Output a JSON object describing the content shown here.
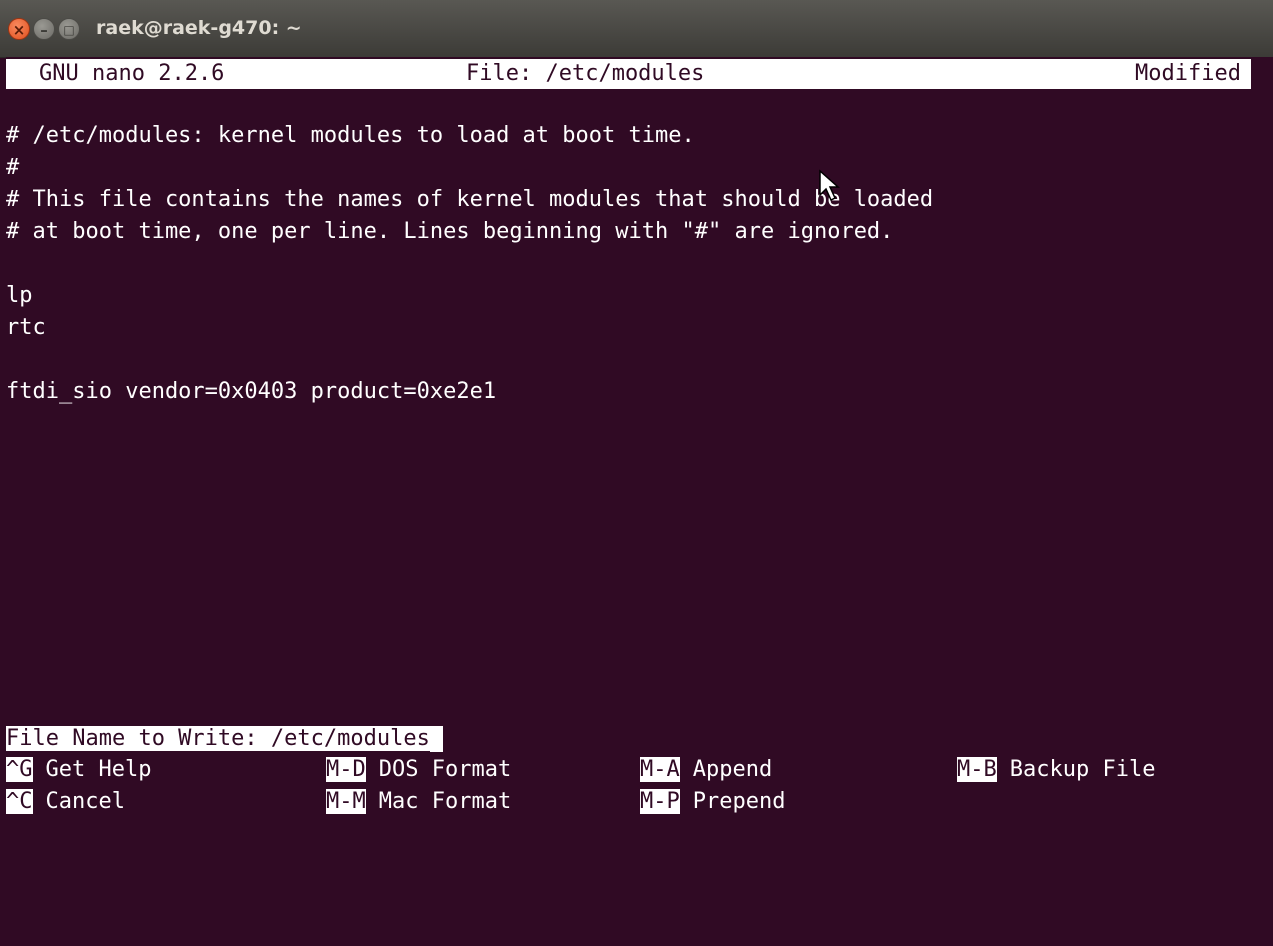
{
  "window": {
    "title": "raek@raek-g470: ~",
    "close_glyph": "×",
    "minimize_glyph": "–",
    "maximize_glyph": "□"
  },
  "nano": {
    "version": "GNU nano 2.2.6",
    "file_label": "File: /etc/modules",
    "status": "Modified"
  },
  "file_lines": [
    "# /etc/modules: kernel modules to load at boot time.",
    "#",
    "# This file contains the names of kernel modules that should be loaded",
    "# at boot time, one per line. Lines beginning with \"#\" are ignored.",
    "",
    "lp",
    "rtc",
    "",
    "ftdi_sio vendor=0x0403 product=0xe2e1"
  ],
  "prompt": {
    "label": "File Name to Write: ",
    "value": "/etc/modules"
  },
  "shortcuts": {
    "row1": [
      {
        "key": "^G",
        "label": "Get Help"
      },
      {
        "key": "M-D",
        "label": "DOS Format"
      },
      {
        "key": "M-A",
        "label": "Append"
      },
      {
        "key": "M-B",
        "label": "Backup File"
      }
    ],
    "row2": [
      {
        "key": "^C",
        "label": "Cancel"
      },
      {
        "key": "M-M",
        "label": "Mac Format"
      },
      {
        "key": "M-P",
        "label": "Prepend"
      }
    ]
  },
  "colors": {
    "terminal_bg": "#300a24",
    "terminal_fg": "#ffffff",
    "titlebar": "#3c3b37",
    "close_button": "#e2501f"
  },
  "icons": {
    "close": "close-icon",
    "minimize": "minimize-icon",
    "maximize": "maximize-icon",
    "pointer": "mouse-pointer-icon"
  }
}
